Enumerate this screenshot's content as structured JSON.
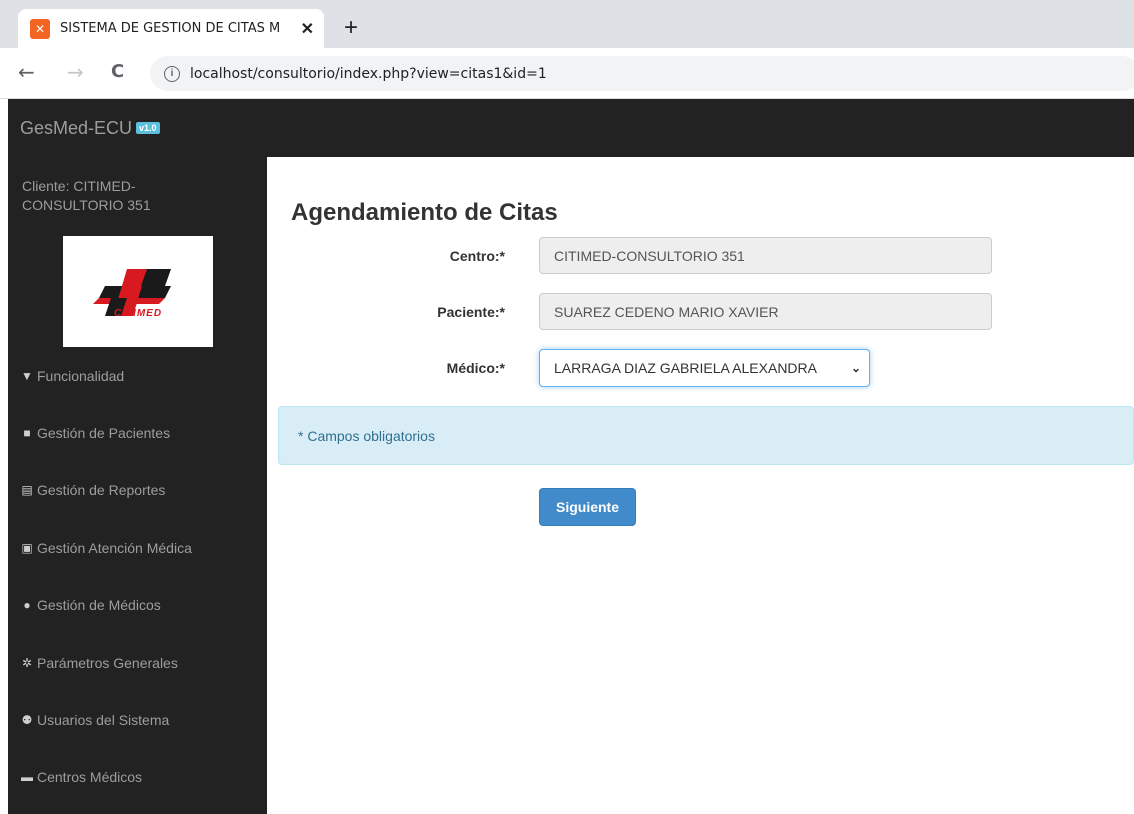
{
  "browser": {
    "tab_title": "SISTEMA DE GESTIÓN DE CITAS M",
    "tab_close": "✕",
    "new_tab": "+",
    "back": "←",
    "forward": "→",
    "reload": "C",
    "url": "localhost/consultorio/index.php?view=citas1&id=1"
  },
  "navbar": {
    "brand": "GesMed-ECU",
    "version": "v1.0"
  },
  "sidebar": {
    "client": "Cliente: CITIMED-CONSULTORIO 351",
    "logo_text": "CITIMED",
    "items": [
      {
        "label": "Funcionalidad",
        "icon": "filter-icon"
      },
      {
        "label": "Gestión de Pacientes",
        "icon": "folder-icon"
      },
      {
        "label": "Gestión de Reportes",
        "icon": "newspaper-icon"
      },
      {
        "label": "Gestión Atención Médica",
        "icon": "id-card-icon"
      },
      {
        "label": "Gestión de Médicos",
        "icon": "user-icon"
      },
      {
        "label": "Parámetros Generales",
        "icon": "gear-icon"
      },
      {
        "label": "Usuarios del Sistema",
        "icon": "users-icon"
      },
      {
        "label": "Centros Médicos",
        "icon": "briefcase-icon"
      }
    ]
  },
  "main": {
    "title": "Agendamiento de Citas",
    "centro_label": "Centro:*",
    "centro_value": "CITIMED-CONSULTORIO 351",
    "paciente_label": "Paciente:*",
    "paciente_value": "SUAREZ CEDENO MARIO XAVIER",
    "medico_label": "Médico:*",
    "medico_value": "LARRAGA DIAZ GABRIELA ALEXANDRA",
    "alert": "* Campos obligatorios",
    "next_button": "Siguiente"
  },
  "colors": {
    "navbar_bg": "#222222",
    "primary": "#428bca",
    "alert_bg": "#d9edf7"
  }
}
